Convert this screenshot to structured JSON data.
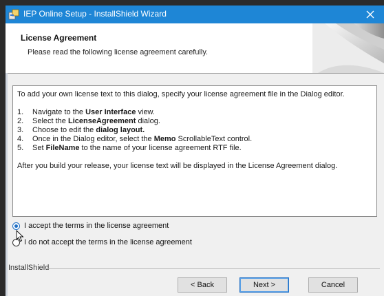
{
  "window": {
    "title": "IEP Online Setup - InstallShield Wizard",
    "accent_color": "#1e86d6"
  },
  "header": {
    "title": "License Agreement",
    "subtitle": "Please read the following license agreement carefully."
  },
  "license": {
    "intro": "To add your own license text to this dialog, specify your license agreement file in the Dialog editor.",
    "steps": [
      {
        "num": "1.",
        "pre": "Navigate to the ",
        "bold": "User Interface",
        "post": " view."
      },
      {
        "num": "2.",
        "pre": "Select the ",
        "bold": "LicenseAgreement",
        "post": " dialog."
      },
      {
        "num": "3.",
        "pre": "Choose to edit the ",
        "bold": "dialog layout.",
        "post": ""
      },
      {
        "num": "4.",
        "pre": "Once in the Dialog editor, select the ",
        "bold": "Memo",
        "post": " ScrollableText control."
      },
      {
        "num": "5.",
        "pre": "Set ",
        "bold": "FileName",
        "post": " to the name of your license agreement RTF file."
      }
    ],
    "outro": "After you build your release, your license text will be displayed in the License Agreement dialog."
  },
  "options": {
    "accept_label": "I accept the terms in the license agreement",
    "decline_label": "I do not accept the terms in the license agreement",
    "selected": "accept"
  },
  "footer": {
    "group_label": "InstallShield",
    "back_label": "< Back",
    "next_label": "Next >",
    "cancel_label": "Cancel"
  },
  "icons": {
    "app": "installer-app-icon",
    "close": "close-icon",
    "header_art": "page-curl-graphic",
    "cursor": "mouse-pointer-icon"
  }
}
